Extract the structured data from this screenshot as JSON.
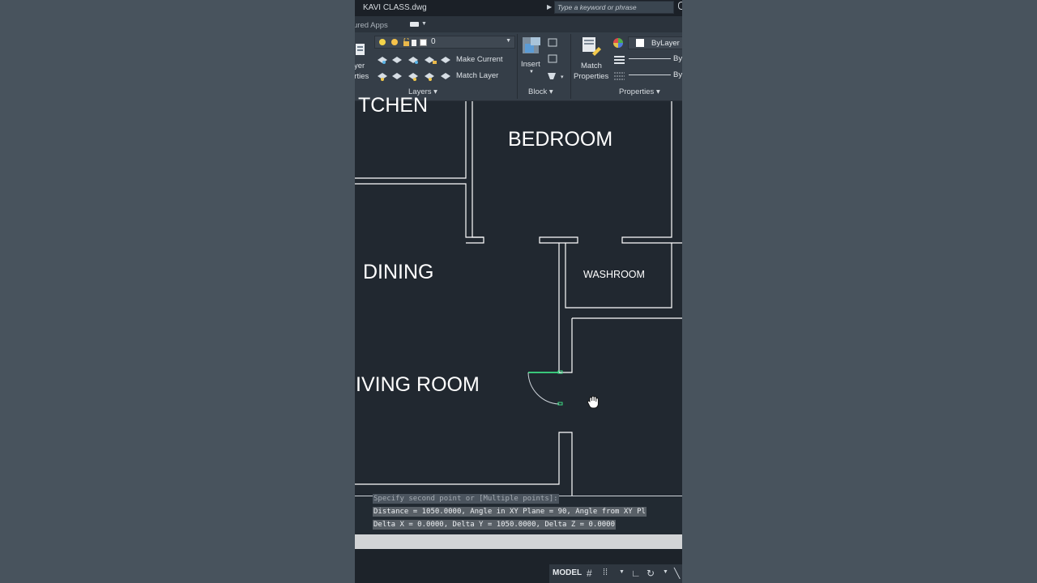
{
  "titlebar": {
    "file_name": "KAVI CLASS.dwg",
    "search_placeholder": "Type a keyword or phrase"
  },
  "tabs": {
    "featured_apps": "ured Apps"
  },
  "ribbon": {
    "layer_properties_line1": "yer",
    "layer_properties_line2": "erties",
    "current_layer": "0",
    "make_current": "Make Current",
    "match_layer": "Match Layer",
    "layers_panel": "Layers",
    "insert": "Insert",
    "block_panel": "Block",
    "match_properties_line1": "Match",
    "match_properties_line2": "Properties",
    "color_value": "ByLayer",
    "linetype_value": "By",
    "lineweight_value": "By",
    "properties_panel": "Properties"
  },
  "drawing": {
    "rooms": {
      "kitchen": "TCHEN",
      "bedroom": "BEDROOM",
      "dining": "DINING",
      "washroom": "WASHROOM",
      "living_room": "IVING ROOM"
    }
  },
  "command_line": {
    "history": "Specify second point or [Multiple points]:",
    "line_distance": "Distance = 1050.0000,  Angle in XY Plane = 90,  Angle from XY Pl",
    "line_delta": "Delta X = 0.0000,  Delta Y = 1050.0000,   Delta Z = 0.0000"
  },
  "statusbar": {
    "model": "MODEL"
  },
  "colors": {
    "canvas": "#212830",
    "ribbon": "#353e48",
    "wall": "#ffffff",
    "door_highlight": "#3ddc84"
  }
}
